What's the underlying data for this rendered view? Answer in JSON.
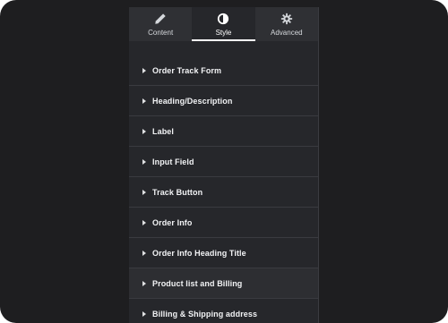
{
  "tabs": [
    {
      "label": "Content",
      "icon": "pencil-icon",
      "active": false
    },
    {
      "label": "Style",
      "icon": "contrast-icon",
      "active": true
    },
    {
      "label": "Advanced",
      "icon": "gear-icon",
      "active": false
    }
  ],
  "sections": [
    {
      "label": "Order Track Form"
    },
    {
      "label": "Heading/Description"
    },
    {
      "label": "Label"
    },
    {
      "label": "Input Field"
    },
    {
      "label": "Track Button"
    },
    {
      "label": "Order Info"
    },
    {
      "label": "Order Info Heading Title"
    },
    {
      "label": "Product list and Billing"
    },
    {
      "label": "Billing & Shipping address"
    }
  ],
  "colors": {
    "background": "#1e1e20",
    "panel": "#26272b",
    "divider": "#3a3b40",
    "text": "#f2f3f5",
    "active_tab_indicator": "#ffffff"
  }
}
